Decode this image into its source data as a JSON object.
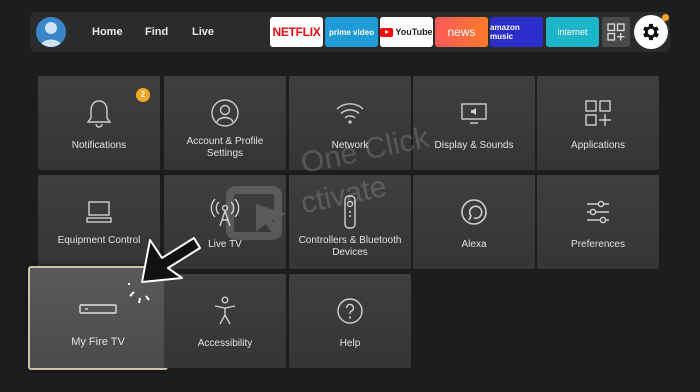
{
  "topbar": {
    "nav": {
      "home": "Home",
      "find": "Find",
      "live": "Live"
    },
    "apps": {
      "netflix": "NETFLIX",
      "prime_video": "prime video",
      "youtube": "YouTube",
      "news": "news",
      "amazon_music": "amazon music",
      "internet": "internet"
    },
    "icons": {
      "profile": "profile-icon",
      "apps_grid": "apps-grid-icon",
      "settings": "gear-icon"
    },
    "colors": {
      "settings_dot": "#f5a623",
      "profile": "#3a86c8"
    }
  },
  "settings_grid": [
    {
      "label": "Notifications",
      "icon": "bell-icon",
      "badge": "2"
    },
    {
      "label": "Account & Profile Settings",
      "icon": "account-icon"
    },
    {
      "label": "Network",
      "icon": "wifi-icon"
    },
    {
      "label": "Display & Sounds",
      "icon": "display-sound-icon"
    },
    {
      "label": "Applications",
      "icon": "applications-icon"
    },
    {
      "label": "Equipment Control",
      "icon": "equipment-icon"
    },
    {
      "label": "Live TV",
      "icon": "antenna-icon"
    },
    {
      "label": "Controllers & Bluetooth Devices",
      "icon": "remote-icon"
    },
    {
      "label": "Alexa",
      "icon": "alexa-icon"
    },
    {
      "label": "Preferences",
      "icon": "sliders-icon"
    },
    {
      "label": "My Fire TV",
      "icon": "firetv-device-icon",
      "selected": true
    },
    {
      "label": "Accessibility",
      "icon": "accessibility-icon"
    },
    {
      "label": "Help",
      "icon": "help-icon"
    }
  ],
  "watermark": {
    "line1": "One Click",
    "line2": "ctivate"
  },
  "colors": {
    "badge": "#f5a623",
    "background": "#1d1d1d",
    "tile": "#3a3a3a",
    "selected_border": "#c9c2a9"
  }
}
